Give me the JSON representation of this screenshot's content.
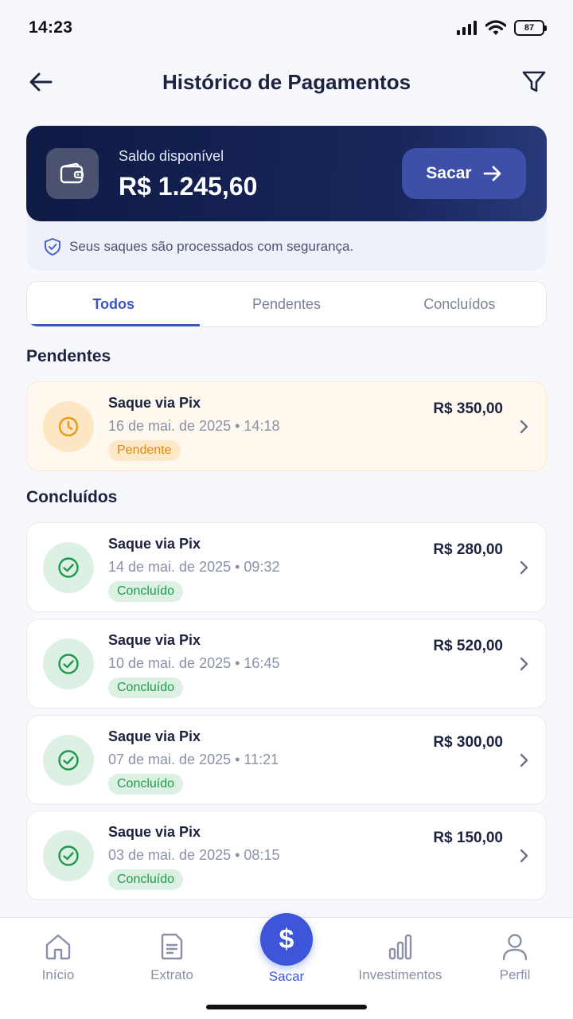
{
  "status_bar": {
    "time": "14:23",
    "battery": "87"
  },
  "header": {
    "title": "Histórico de Pagamentos"
  },
  "balance": {
    "label": "Saldo disponível",
    "value": "R$ 1.245,60",
    "button_label": "Sacar",
    "security_note": "Seus saques são processados com segurança."
  },
  "tabs": [
    {
      "label": "Todos",
      "active": true
    },
    {
      "label": "Pendentes",
      "active": false
    },
    {
      "label": "Concluídos",
      "active": false
    }
  ],
  "sections": {
    "pending_title": "Pendentes",
    "completed_title": "Concluídos"
  },
  "pending": [
    {
      "title": "Saque via Pix",
      "date": "16 de mai. de 2025 • 14:18",
      "status": "Pendente",
      "amount": "R$ 350,00"
    }
  ],
  "completed": [
    {
      "title": "Saque via Pix",
      "date": "14 de mai. de 2025 • 09:32",
      "status": "Concluído",
      "amount": "R$ 280,00"
    },
    {
      "title": "Saque via Pix",
      "date": "10 de mai. de 2025 • 16:45",
      "status": "Concluído",
      "amount": "R$ 520,00"
    },
    {
      "title": "Saque via Pix",
      "date": "07 de mai. de 2025 • 11:21",
      "status": "Concluído",
      "amount": "R$ 300,00"
    },
    {
      "title": "Saque via Pix",
      "date": "03 de mai. de 2025 • 08:15",
      "status": "Concluído",
      "amount": "R$ 150,00"
    }
  ],
  "bottom_nav": {
    "home": "Início",
    "statement": "Extrato",
    "withdraw": "Sacar",
    "withdraw_symbol": "$",
    "investments": "Investimentos",
    "profile": "Perfil"
  },
  "colors": {
    "primary": "#3d55c9",
    "card_dark": "#0f1b45",
    "pending": "#d98a10",
    "success": "#1f9a4d"
  }
}
